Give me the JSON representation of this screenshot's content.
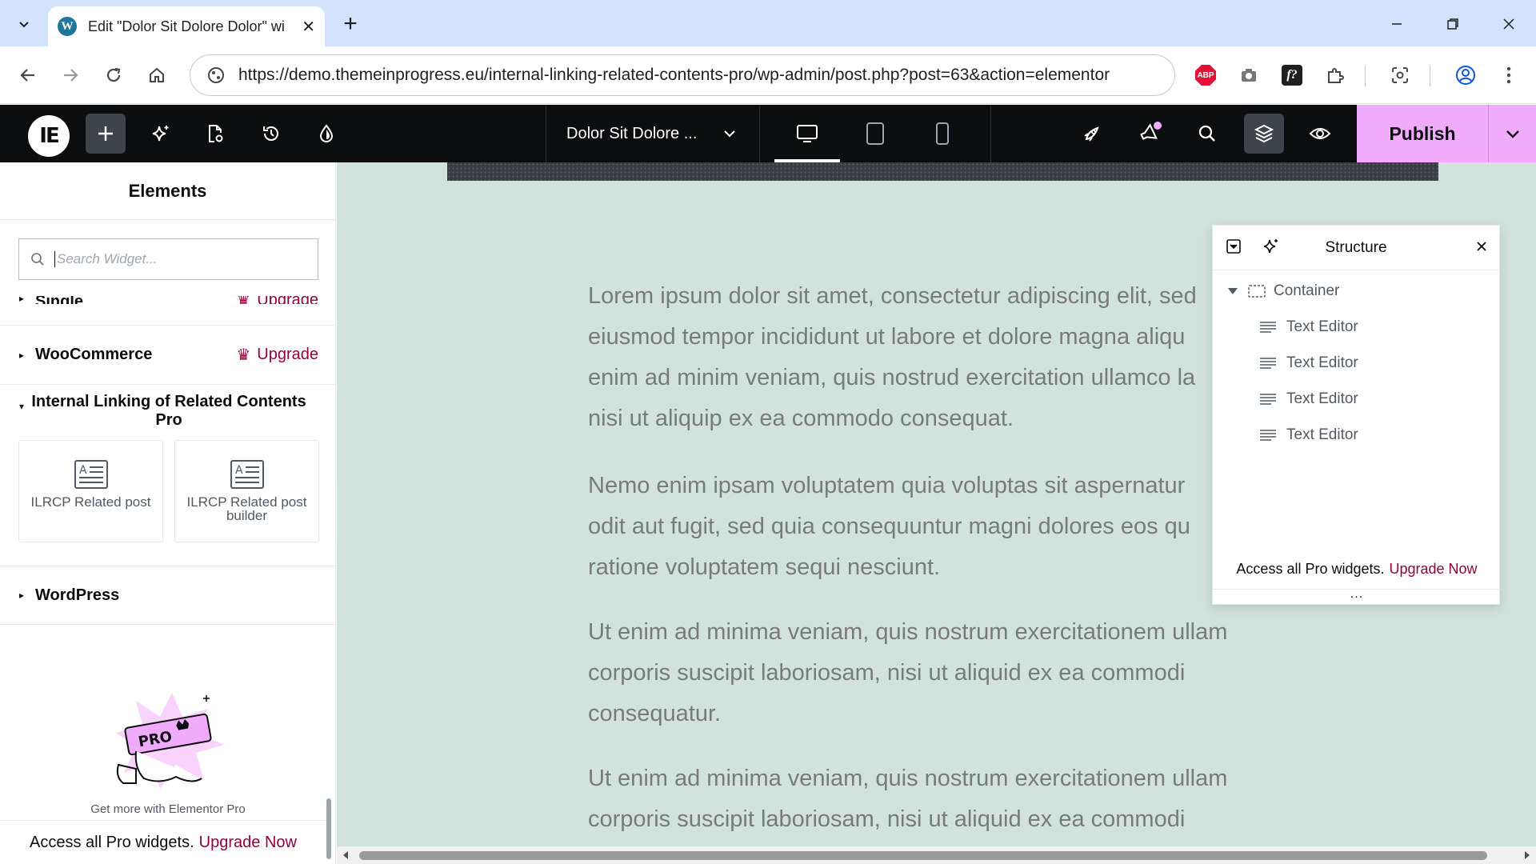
{
  "browser": {
    "tab_title": "Edit \"Dolor Sit Dolore Dolor\" wi",
    "tab_close": "✕",
    "new_tab": "+",
    "url": "https://demo.themeinprogress.eu/internal-linking-related-contents-pro/wp-admin/post.php?post=63&action=elementor",
    "favicon_letter": "W",
    "ext_abp": "ABP",
    "ext_f": "f?"
  },
  "editor": {
    "logo": "IE",
    "document_title": "Dolor Sit Dolore ...",
    "publish_label": "Publish",
    "accent": "#f0abfc"
  },
  "panel": {
    "title": "Elements",
    "search_placeholder": "Search Widget...",
    "categories": [
      {
        "name": "Single",
        "upgrade": "Upgrade"
      },
      {
        "name": "WooCommerce",
        "upgrade": "Upgrade"
      },
      {
        "name": "Internal Linking of Related Contents Pro",
        "expanded": true
      },
      {
        "name": "WordPress"
      }
    ],
    "widgets": [
      {
        "label": "ILRCP Related post"
      },
      {
        "label": "ILRCP Related post builder"
      }
    ],
    "promo_text": "Get more with Elementor Pro",
    "footer_text": "Access all Pro widgets.",
    "footer_link": "Upgrade Now"
  },
  "canvas": {
    "paragraphs": [
      [
        "Lorem ipsum dolor sit amet, consectetur adipiscing elit, sed",
        "eiusmod tempor incididunt ut labore et dolore magna aliqu",
        "enim ad minim veniam, quis nostrud exercitation ullamco la",
        "nisi ut aliquip ex ea commodo consequat."
      ],
      [
        "Nemo enim ipsam voluptatem quia voluptas sit aspernatur",
        "odit aut fugit, sed quia consequuntur magni dolores eos qu",
        "ratione voluptatem sequi nesciunt."
      ],
      [
        "Ut enim ad minima veniam, quis nostrum exercitationem ullam",
        "corporis suscipit laboriosam, nisi ut aliquid ex ea commodi",
        "consequatur."
      ],
      [
        "Ut enim ad minima veniam, quis nostrum exercitationem ullam",
        "corporis suscipit laboriosam, nisi ut aliquid ex ea commodi"
      ]
    ]
  },
  "structure": {
    "title": "Structure",
    "container_label": "Container",
    "items": [
      "Text Editor",
      "Text Editor",
      "Text Editor",
      "Text Editor"
    ],
    "footer_text": "Access all Pro widgets.",
    "footer_link": "Upgrade Now",
    "grip": "..."
  }
}
